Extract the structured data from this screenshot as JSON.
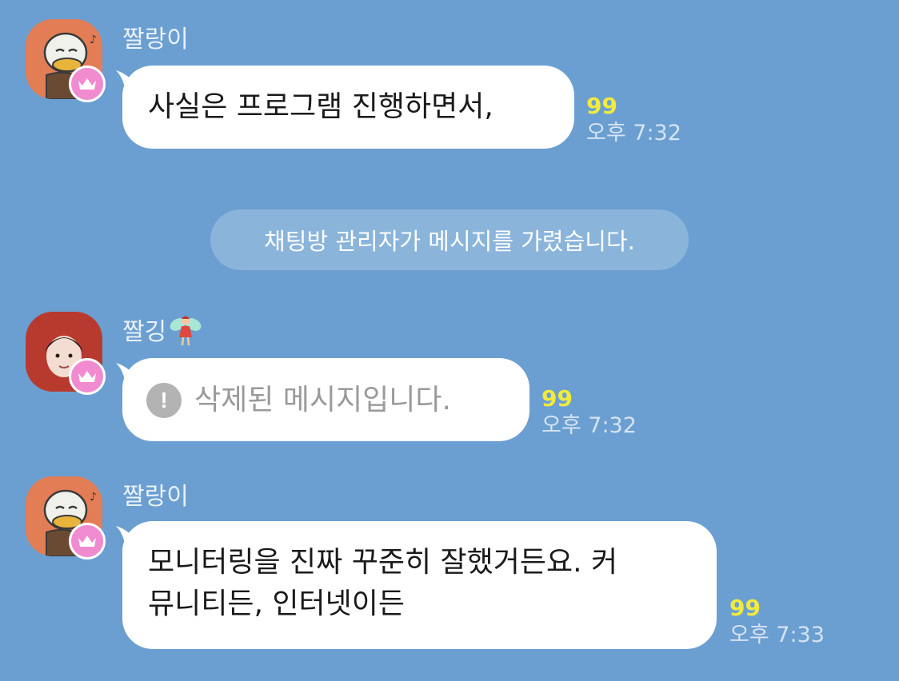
{
  "messages": [
    {
      "sender": "짤랑이",
      "text": "사실은 프로그램 진행하면서,",
      "unread": "99",
      "time": "오후 7:32",
      "avatar": "character-duck-avatar",
      "badge": "crown-icon"
    },
    {
      "sender": "짤깅",
      "sender_emoji": "🧚",
      "text": "삭제된 메시지입니다.",
      "deleted_icon": "!",
      "unread": "99",
      "time": "오후 7:32",
      "avatar": "photo-avatar",
      "badge": "crown-icon"
    },
    {
      "sender": "짤랑이",
      "text_line1": "모니터링을 진짜 꾸준히 잘했거든요. 커",
      "text_line2": "뮤니티든, 인터넷이든",
      "unread": "99",
      "time": "오후 7:33",
      "avatar": "character-duck-avatar",
      "badge": "crown-icon"
    }
  ],
  "notice": {
    "text": "채팅방 관리자가 메시지를 가렸습니다."
  },
  "colors": {
    "background": "#6b9fd1",
    "bubble": "#ffffff",
    "unread": "#f2ea3c",
    "badge": "#f08bd0",
    "deleted_text": "#9a9a9a"
  }
}
